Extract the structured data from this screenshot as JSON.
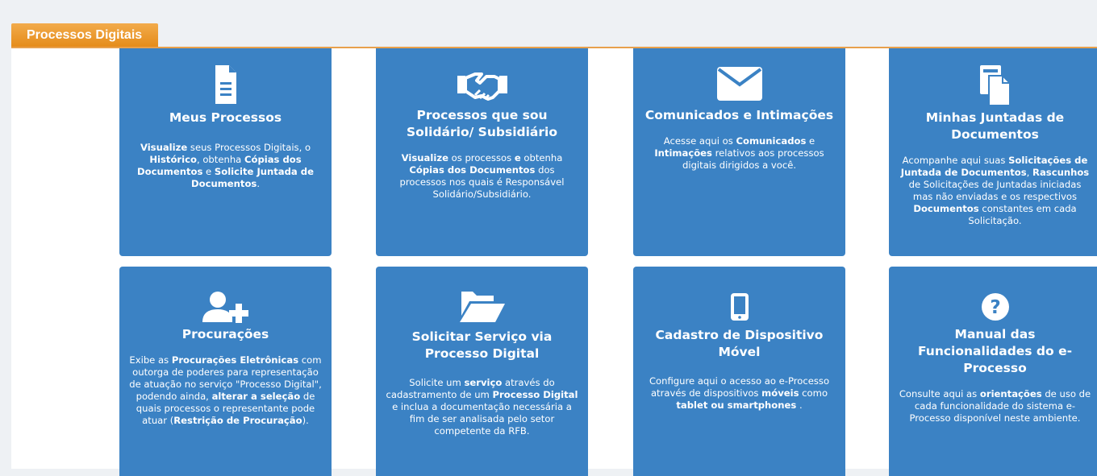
{
  "section": {
    "title": "Processos Digitais"
  },
  "cards": [
    {
      "icon": "document-icon",
      "title": "Meus Processos",
      "description": [
        {
          "t": "Visualize",
          "b": true
        },
        {
          "t": " seus Processos Digitais, o ",
          "b": false
        },
        {
          "t": "Histórico",
          "b": true
        },
        {
          "t": ", obtenha ",
          "b": false
        },
        {
          "t": "Cópias dos Documentos",
          "b": true
        },
        {
          "t": " e ",
          "b": false
        },
        {
          "t": "Solicite Juntada de Documentos",
          "b": true
        },
        {
          "t": ".",
          "b": false
        }
      ]
    },
    {
      "icon": "handshake-icon",
      "title": "Processos que sou Solidário/ Subsidiário",
      "description": [
        {
          "t": "Visualize",
          "b": true
        },
        {
          "t": " os processos ",
          "b": false
        },
        {
          "t": "e",
          "b": true
        },
        {
          "t": " obtenha ",
          "b": false
        },
        {
          "t": "Cópias dos Documentos",
          "b": true
        },
        {
          "t": " dos processos nos quais é Responsável Solidário/Subsidiário.",
          "b": false
        }
      ]
    },
    {
      "icon": "envelope-icon",
      "title": "Comunicados e Intimações",
      "description": [
        {
          "t": "Acesse aqui os ",
          "b": false
        },
        {
          "t": "Comunicados",
          "b": true
        },
        {
          "t": " e ",
          "b": false
        },
        {
          "t": "Intimações",
          "b": true
        },
        {
          "t": " relativos aos processos digitais dirigidos a você.",
          "b": false
        }
      ]
    },
    {
      "icon": "copy-documents-icon",
      "title": "Minhas Juntadas de Documentos",
      "description": [
        {
          "t": "Acompanhe aqui suas ",
          "b": false
        },
        {
          "t": "Solicitações de Juntada de Documentos",
          "b": true
        },
        {
          "t": ", ",
          "b": false
        },
        {
          "t": "Rascunhos",
          "b": true
        },
        {
          "t": " de Solicitações de Juntadas iniciadas mas não enviadas e os respectivos ",
          "b": false
        },
        {
          "t": "Documentos",
          "b": true
        },
        {
          "t": " constantes em cada Solicitação.",
          "b": false
        }
      ]
    },
    {
      "icon": "user-plus-icon",
      "title": "Procurações",
      "description": [
        {
          "t": "Exibe as ",
          "b": false
        },
        {
          "t": "Procurações Eletrônicas",
          "b": true
        },
        {
          "t": " com outorga de poderes para representação de atuação no serviço \"Processo Digital\", podendo ainda, ",
          "b": false
        },
        {
          "t": "alterar a seleção",
          "b": true
        },
        {
          "t": " de quais processos o representante pode atuar (",
          "b": false
        },
        {
          "t": "Restrição de Procuração",
          "b": true
        },
        {
          "t": ").",
          "b": false
        }
      ]
    },
    {
      "icon": "folder-open-icon",
      "title": "Solicitar Serviço via Processo Digital",
      "description": [
        {
          "t": "Solicite um ",
          "b": false
        },
        {
          "t": "serviço",
          "b": true
        },
        {
          "t": " através do cadastramento de um ",
          "b": false
        },
        {
          "t": "Processo Digital",
          "b": true
        },
        {
          "t": " e inclua a documentação necessária a fim de ser analisada pelo setor competente da RFB.",
          "b": false
        }
      ]
    },
    {
      "icon": "mobile-icon",
      "title": "Cadastro de Dispositivo Móvel",
      "description": [
        {
          "t": "Configure aqui o acesso ao e-Processo através de dispositivos ",
          "b": false
        },
        {
          "t": "móveis",
          "b": true
        },
        {
          "t": " como ",
          "b": false
        },
        {
          "t": "tablet ou smartphones",
          "b": true
        },
        {
          "t": " .",
          "b": false
        }
      ]
    },
    {
      "icon": "question-circle-icon",
      "title": "Manual das Funcionalidades do e-Processo",
      "description": [
        {
          "t": "Consulte aqui as ",
          "b": false
        },
        {
          "t": "orientações",
          "b": true
        },
        {
          "t": " de uso de cada funcionalidade do sistema e-Processo disponível neste ambiente.",
          "b": false
        }
      ]
    }
  ]
}
